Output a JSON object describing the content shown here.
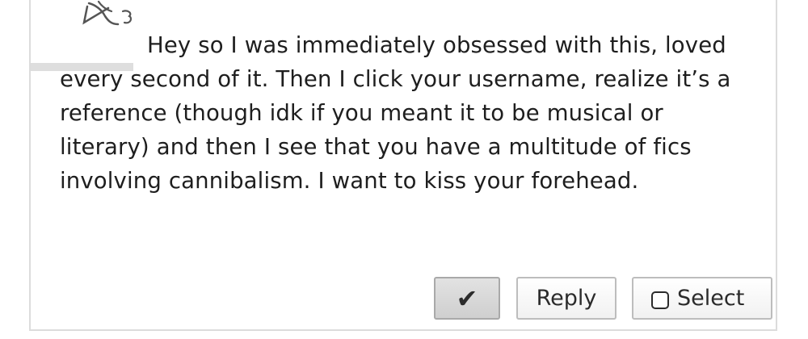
{
  "comment": {
    "text": "Hey so I was immediately obsessed with this, loved every second of it. Then I click your username, realize it’s a reference (though idk if you meant it to be musical or literary) and then I see that you have a multitude of fics involving cannibalism. I want to kiss your forehead."
  },
  "actions": {
    "kudos_glyph": "✔",
    "reply_label": "Reply",
    "select_label": "Select"
  },
  "icons": {
    "avatar": "sketch-avatar-icon",
    "kudos": "checkmark-icon",
    "select": "checkbox-icon"
  },
  "colors": {
    "text": "#1e1e1e",
    "border": "#dcdcdc",
    "button_border": "#bdbdbd",
    "active_button": "#d5d5d5"
  }
}
